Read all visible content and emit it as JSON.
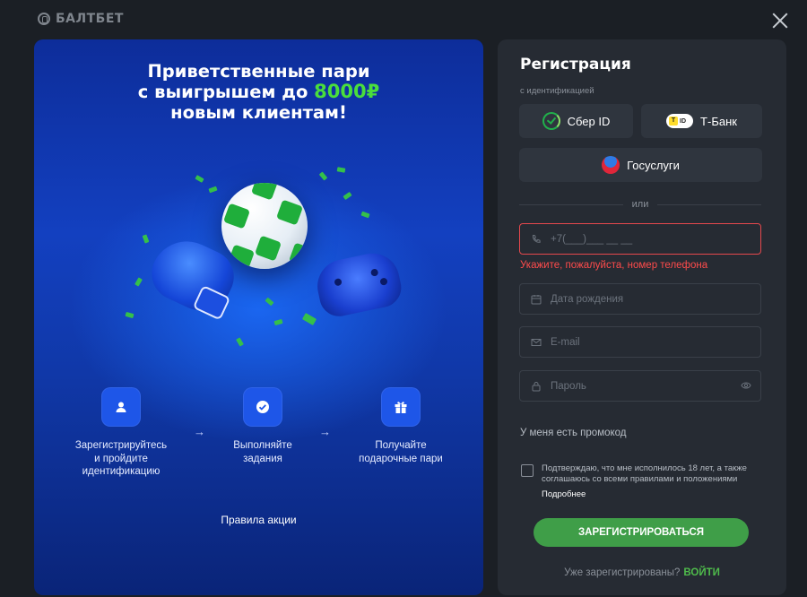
{
  "header": {
    "logo_text": "БАЛТБЕТ"
  },
  "promo": {
    "title_line1": "Приветственные пари",
    "title_line2_prefix": "с выигрышем до ",
    "title_amount": "8000₽",
    "title_line3": "новым клиентам!",
    "accent_color": "#4ade3c",
    "steps": [
      {
        "icon": "user-icon",
        "label_line1": "Зарегистрируйтесь",
        "label_line2": "и пройдите",
        "label_line3": "идентификацию"
      },
      {
        "icon": "check-circle-icon",
        "label_line1": "Выполняйте",
        "label_line2": "задания"
      },
      {
        "icon": "gift-icon",
        "label_line1": "Получайте",
        "label_line2": "подарочные пари"
      }
    ],
    "rules_link": "Правила акции"
  },
  "form": {
    "title": "Регистрация",
    "id_caption": "с идентификацией",
    "sber_label": "Сбер ID",
    "tbank_label": "Т-Банк",
    "tbank_badge": "ID",
    "gosuslugi_label": "Госуслуги",
    "or_label": "или",
    "phone": {
      "placeholder": "+7(___)___ __ __",
      "error": "Укажите, пожалуйста, номер телефона"
    },
    "birthdate_placeholder": "Дата рождения",
    "email_placeholder": "E-mail",
    "password_placeholder": "Пароль",
    "promo_code_link": "У меня есть промокод",
    "consent_text": "Подтверждаю, что мне исполнилось 18 лет, а также соглашаюсь со всеми правилами и положениями",
    "more_link": "Подробнее",
    "submit_label": "ЗАРЕГИСТРИРОВАТЬСЯ",
    "already_text": "Уже зарегистрированы?",
    "login_link": "ВОЙТИ",
    "brand_green": "#3f9e48",
    "error_red": "#e5484d"
  }
}
